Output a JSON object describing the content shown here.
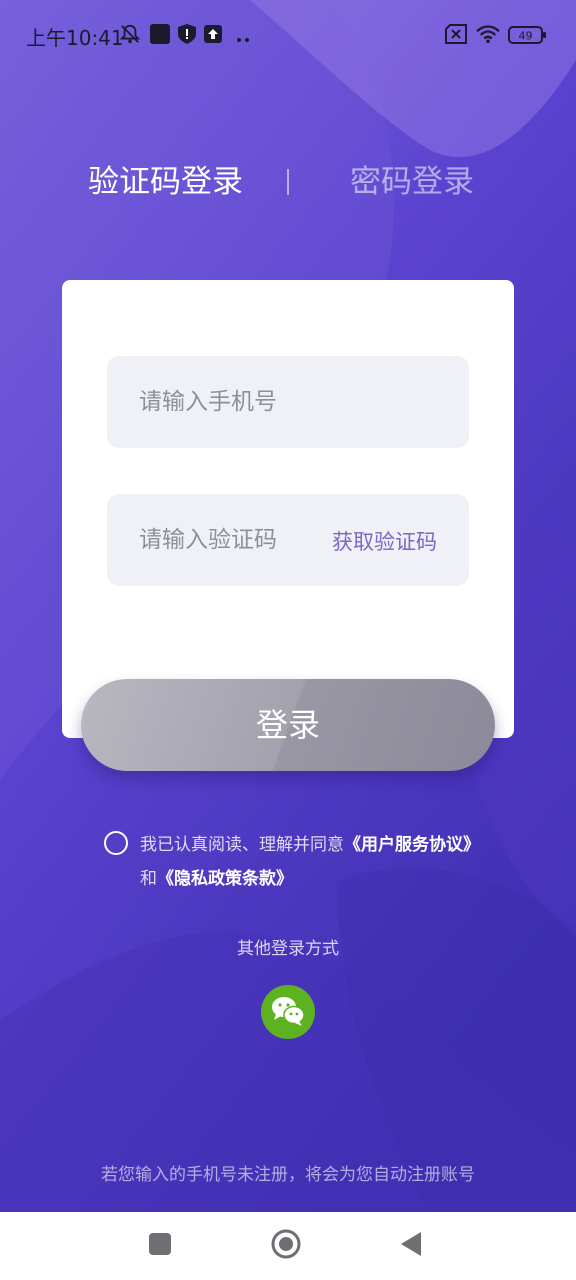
{
  "status_bar": {
    "time": "上午10:41",
    "icons": [
      "mute-bell-icon",
      "app-square-icon",
      "shield-icon",
      "upload-icon",
      "more-dots-icon",
      "sim-off-icon",
      "wifi-icon",
      "battery-icon"
    ],
    "battery_level": "49"
  },
  "tabs": {
    "code_login": "验证码登录",
    "password_login": "密码登录",
    "active": "code_login"
  },
  "form": {
    "phone_placeholder": "请输入手机号",
    "phone_value": "",
    "code_placeholder": "请输入验证码",
    "code_value": "",
    "get_code_label": "获取验证码",
    "login_label": "登录"
  },
  "agreement": {
    "checked": false,
    "prefix": "我已认真阅读、理解并同意",
    "user_agreement": "《用户服务协议》",
    "conjunction": "和",
    "privacy_policy": "《隐私政策条款》"
  },
  "other_login": {
    "label": "其他登录方式",
    "methods": [
      "wechat-icon"
    ]
  },
  "footer_tip": "若您输入的手机号未注册，将会为您自动注册账号",
  "colors": {
    "background_top": "#7a64dc",
    "background_bottom": "#4a35b8",
    "accent_text": "#7a67c6",
    "wechat_green": "#5cb31f"
  }
}
